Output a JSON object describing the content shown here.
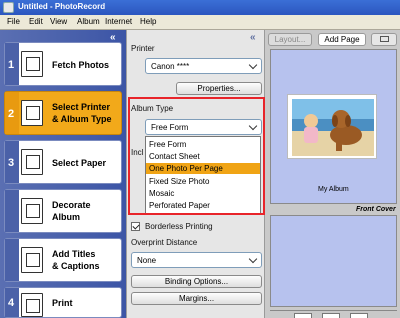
{
  "window": {
    "title": "Untitled - PhotoRecord"
  },
  "menu": [
    "File",
    "Edit",
    "View",
    "Album",
    "Internet",
    "Help"
  ],
  "steps": [
    {
      "num": "1",
      "label_1": "Fetch Photos",
      "label_2": ""
    },
    {
      "num": "2",
      "label_1": "Select Printer",
      "label_2": "& Album Type"
    },
    {
      "num": "3",
      "label_1": "Select Paper",
      "label_2": ""
    },
    {
      "num": "",
      "label_1": "Decorate",
      "label_2": "Album"
    },
    {
      "num": "",
      "label_1": "Add Titles",
      "label_2": "& Captions"
    },
    {
      "num": "4",
      "label_1": "Print",
      "label_2": ""
    }
  ],
  "settings": {
    "printer_label": "Printer",
    "printer_value": "Canon ****",
    "properties_button": "Properties...",
    "album_type_label": "Album Type",
    "album_type_value": "Free Form",
    "hidden_label": "Incl",
    "album_type_options": [
      "Free Form",
      "Contact Sheet",
      "One Photo Per Page",
      "Fixed Size Photo",
      "Mosaic",
      "Perforated Paper"
    ],
    "selected_option": "One Photo Per Page",
    "borderless_label": "Borderless Printing",
    "overprint_label": "Overprint Distance",
    "overprint_value": "None",
    "binding_button": "Binding Options...",
    "margins_button": "Margins..."
  },
  "preview": {
    "layout_button": "Layout...",
    "add_page_button": "Add Page",
    "album_caption": "My Album",
    "front_cover_label": "Front Cover"
  },
  "colors": {
    "accent_orange": "#f2a91a",
    "highlight_red": "#e8242a",
    "step_blue": "#3c55a6",
    "page_blue": "#b7c2ee"
  }
}
